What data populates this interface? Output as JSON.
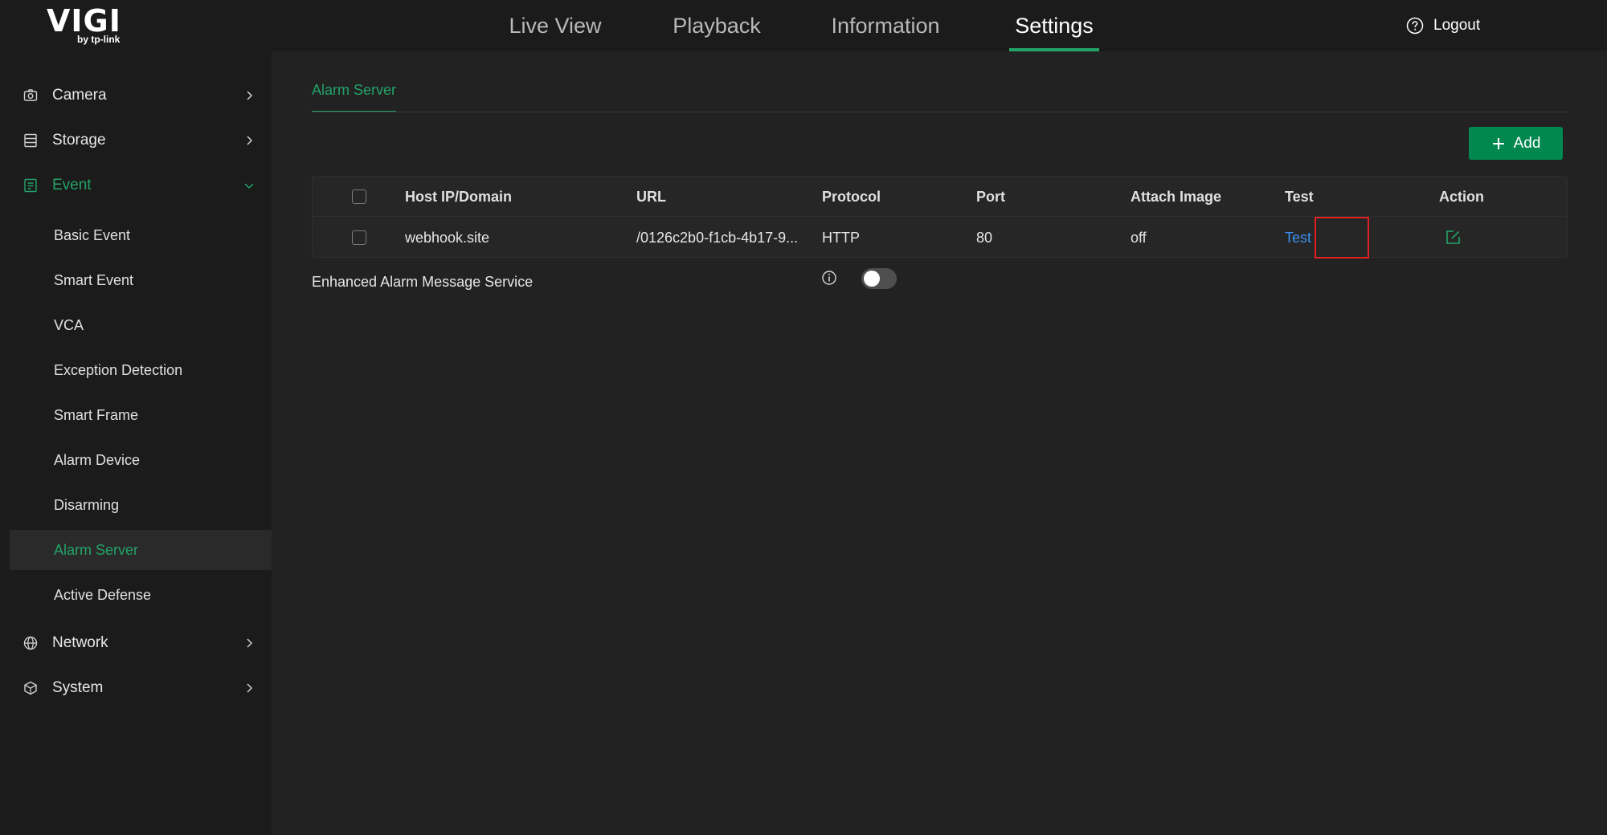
{
  "brand": {
    "name": "VIGI",
    "tagline": "by tp-link"
  },
  "topnav": {
    "items": [
      {
        "label": "Live View"
      },
      {
        "label": "Playback"
      },
      {
        "label": "Information"
      },
      {
        "label": "Settings"
      }
    ],
    "active": "Settings",
    "logout_label": "Logout"
  },
  "sidebar": {
    "groups": [
      {
        "label": "Camera",
        "icon": "camera-icon",
        "expanded": false
      },
      {
        "label": "Storage",
        "icon": "storage-icon",
        "expanded": false
      },
      {
        "label": "Event",
        "icon": "event-icon",
        "expanded": true
      },
      {
        "label": "Network",
        "icon": "globe-icon",
        "expanded": false
      },
      {
        "label": "System",
        "icon": "cube-icon",
        "expanded": false
      }
    ],
    "event_items": [
      {
        "label": "Basic Event"
      },
      {
        "label": "Smart Event"
      },
      {
        "label": "VCA"
      },
      {
        "label": "Exception Detection"
      },
      {
        "label": "Smart Frame"
      },
      {
        "label": "Alarm Device"
      },
      {
        "label": "Disarming"
      },
      {
        "label": "Alarm Server"
      },
      {
        "label": "Active Defense"
      }
    ],
    "active_item": "Alarm Server"
  },
  "main": {
    "subtab": "Alarm Server",
    "add_label": "Add",
    "table": {
      "headers": [
        "Host IP/Domain",
        "URL",
        "Protocol",
        "Port",
        "Attach Image",
        "Test",
        "Action"
      ],
      "rows": [
        {
          "host": "webhook.site",
          "url": "/0126c2b0-f1cb-4b17-9...",
          "protocol": "HTTP",
          "port": "80",
          "attach_image": "off",
          "test": "Test"
        }
      ]
    },
    "enhanced_label": "Enhanced Alarm Message Service",
    "enhanced_enabled": false
  },
  "colors": {
    "accent": "#23a268",
    "button": "#00884f",
    "link": "#3c8ff0",
    "highlight_box": "#e02020",
    "topbar_bg": "#1b1b1b",
    "main_bg": "#222222"
  }
}
